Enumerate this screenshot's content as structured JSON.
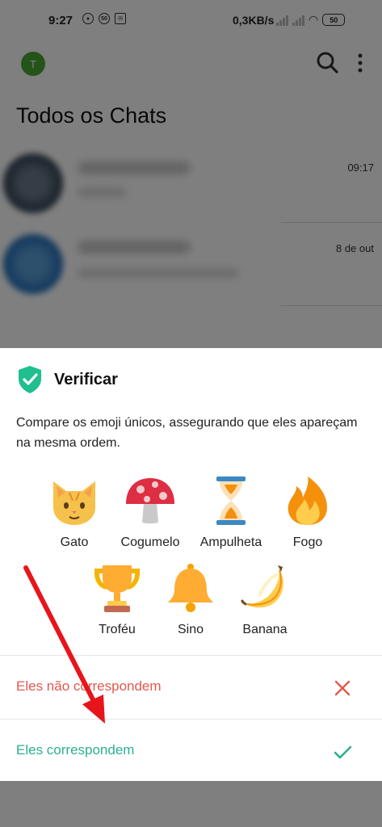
{
  "status_bar": {
    "time": "9:27",
    "network_speed": "0,3KB/s",
    "battery": "50",
    "badge": "50"
  },
  "header": {
    "avatar_initial": "T",
    "title": "Todos os Chats"
  },
  "chats": [
    {
      "time": "09:17"
    },
    {
      "time": "8 de out"
    }
  ],
  "dialog": {
    "title": "Verificar",
    "description": "Compare os emoji únicos, assegurando que eles apareçam na mesma ordem.",
    "emojis": [
      {
        "label": "Gato",
        "icon": "cat-face-icon"
      },
      {
        "label": "Cogumelo",
        "icon": "mushroom-icon"
      },
      {
        "label": "Ampulheta",
        "icon": "hourglass-icon"
      },
      {
        "label": "Fogo",
        "icon": "fire-icon"
      },
      {
        "label": "Troféu",
        "icon": "trophy-icon"
      },
      {
        "label": "Sino",
        "icon": "bell-icon"
      },
      {
        "label": "Banana",
        "icon": "banana-icon"
      }
    ],
    "reject_label": "Eles não correspondem",
    "accept_label": "Eles correspondem"
  },
  "colors": {
    "accept": "#2bb08f",
    "reject": "#e2584e",
    "shield": "#1fbf8f",
    "annotation_arrow": "#e8141c"
  }
}
